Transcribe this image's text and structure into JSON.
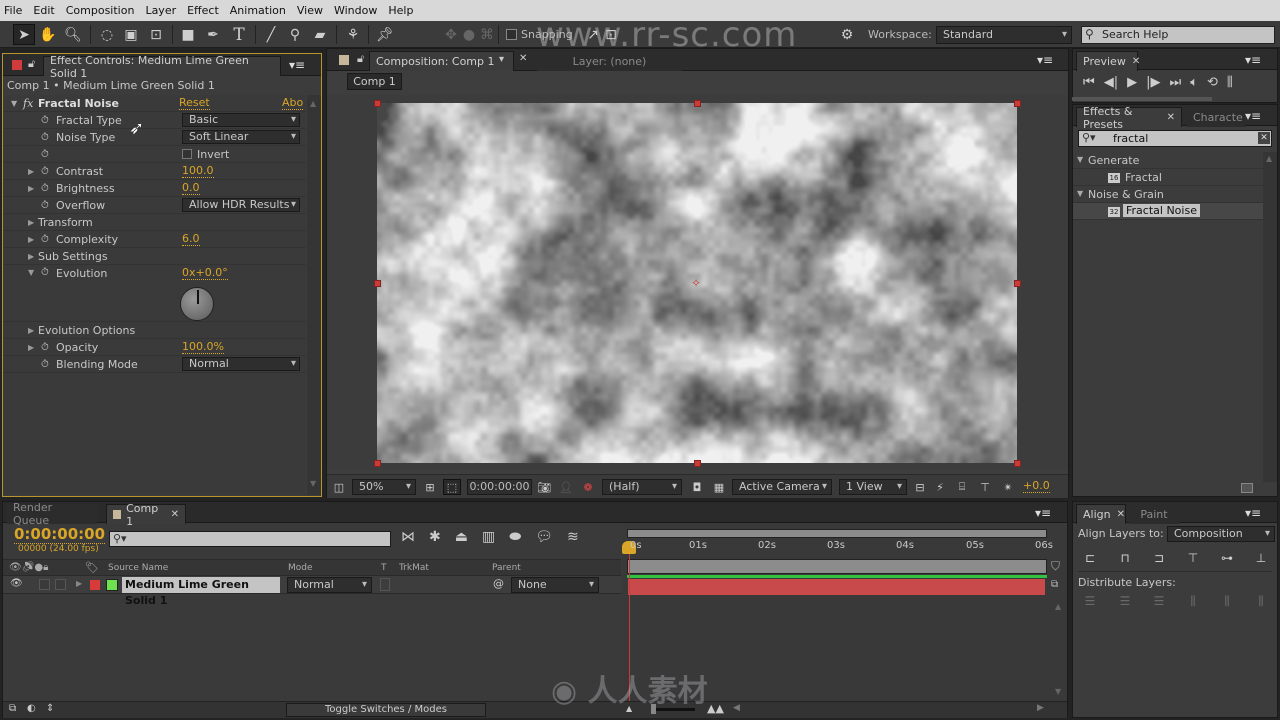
{
  "menubar": [
    "File",
    "Edit",
    "Composition",
    "Layer",
    "Effect",
    "Animation",
    "View",
    "Window",
    "Help"
  ],
  "toolbar": {
    "tools": [
      "selection-tool",
      "hand-tool",
      "zoom-tool",
      "rotation-tool",
      "camera-tool",
      "pan-behind-tool",
      "rectangle-tool",
      "pen-tool",
      "type-tool",
      "brush-tool",
      "clone-stamp-tool",
      "eraser-tool",
      "roto-brush-tool",
      "puppet-pin-tool"
    ],
    "snapping_label": "Snapping",
    "snapping_checked": false,
    "workspace_label": "Workspace:",
    "workspace_value": "Standard",
    "search_help_placeholder": "Search Help"
  },
  "watermark": "www.rr-sc.com",
  "effect_controls": {
    "tab_label": "Effect Controls: Medium Lime Green Solid 1",
    "breadcrumb": "Comp 1 • Medium Lime Green Solid 1",
    "effect_name": "Fractal Noise",
    "reset_label": "Reset",
    "about_label": "Abo",
    "properties": [
      {
        "name": "Fractal Type",
        "type": "dropdown",
        "value": "Basic",
        "stopwatch": true,
        "expandable": false
      },
      {
        "name": "Noise Type",
        "type": "dropdown",
        "value": "Soft Linear",
        "stopwatch": true,
        "expandable": false
      },
      {
        "name": "",
        "type": "checkbox",
        "value": "Invert",
        "checked": false,
        "stopwatch": true,
        "expandable": false
      },
      {
        "name": "Contrast",
        "type": "number",
        "value": "100.0",
        "stopwatch": true,
        "expandable": true
      },
      {
        "name": "Brightness",
        "type": "number",
        "value": "0.0",
        "stopwatch": true,
        "expandable": true
      },
      {
        "name": "Overflow",
        "type": "dropdown",
        "value": "Allow HDR Results",
        "stopwatch": true,
        "expandable": false
      },
      {
        "name": "Transform",
        "type": "group",
        "stopwatch": false,
        "expandable": true
      },
      {
        "name": "Complexity",
        "type": "number",
        "value": "6.0",
        "stopwatch": true,
        "expandable": true
      },
      {
        "name": "Sub Settings",
        "type": "group",
        "stopwatch": false,
        "expandable": true
      },
      {
        "name": "Evolution",
        "type": "angle",
        "value": "0x+0.0°",
        "stopwatch": true,
        "expanded": true
      },
      {
        "name": "Evolution Options",
        "type": "group",
        "stopwatch": false,
        "expandable": true
      },
      {
        "name": "Opacity",
        "type": "number",
        "value": "100.0%",
        "stopwatch": true,
        "expandable": true
      },
      {
        "name": "Blending Mode",
        "type": "dropdown",
        "value": "Normal",
        "stopwatch": true,
        "expandable": false
      }
    ]
  },
  "composition": {
    "tab_label": "Composition: Comp 1",
    "layer_tab_label": "Layer: (none)",
    "comp_button": "Comp 1",
    "viewer": {
      "zoom": "50%",
      "timecode": "0:00:00:00",
      "resolution": "(Half)",
      "camera": "Active Camera",
      "views": "1 View",
      "exposure": "+0.0"
    }
  },
  "preview": {
    "tab_label": "Preview",
    "controls": [
      "first-frame",
      "previous-frame",
      "play",
      "next-frame",
      "last-frame",
      "audio",
      "loop",
      "ram-preview"
    ]
  },
  "effects_presets": {
    "tab_label": "Effects & Presets",
    "other_tab": "Characte",
    "search_value": "fractal",
    "tree": [
      {
        "category": "Generate",
        "items": [
          {
            "label": "Fractal",
            "bit": "16",
            "selected": false
          }
        ]
      },
      {
        "category": "Noise & Grain",
        "items": [
          {
            "label": "Fractal Noise",
            "bit": "32",
            "selected": true
          }
        ]
      }
    ]
  },
  "timeline": {
    "tabs": [
      {
        "label": "Render Queue",
        "active": false
      },
      {
        "label": "Comp 1",
        "active": true
      }
    ],
    "timecode": "0:00:00:00",
    "frame_info": "00000 (24.00 fps)",
    "search_placeholder": "",
    "columns": {
      "source_name": "Source Name",
      "mode": "Mode",
      "t": "T",
      "trkmat": "TrkMat",
      "parent": "Parent"
    },
    "layers": [
      {
        "name": "Medium Lime Green Solid 1",
        "label_color": "#d93a3a",
        "solid_color": "#6ee14e",
        "mode": "Normal",
        "parent": "None"
      }
    ],
    "ruler": [
      "0s",
      "01s",
      "02s",
      "03s",
      "04s",
      "05s",
      "06s"
    ],
    "toggle_label": "Toggle Switches / Modes"
  },
  "align": {
    "tab_label": "Align",
    "other_tab": "Paint",
    "align_to_label": "Align Layers to:",
    "align_to_value": "Composition",
    "distribute_label": "Distribute Layers:"
  },
  "colors": {
    "accent_value": "#d9a628",
    "handle": "#c83c3c",
    "layer_bar": "#c84a4a",
    "work_area": "#34c040"
  }
}
